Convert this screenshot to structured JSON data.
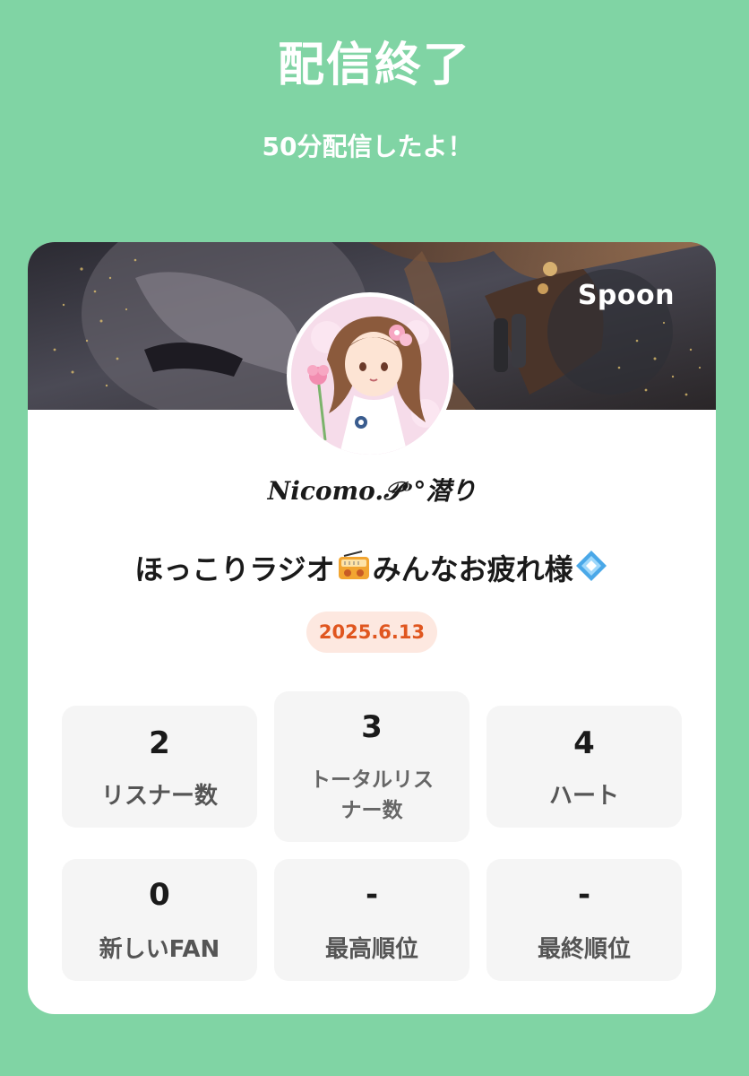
{
  "header": {
    "title": "配信終了",
    "subtitle": "50分配信したよ！"
  },
  "card": {
    "brand": "Spoon",
    "username": "Nicomo.𝒫ᵒ°潜り",
    "broadcast_title": {
      "part1": "ほっこりラジオ",
      "part2": "みんなお疲れ様"
    },
    "date": "2025.6.13",
    "icons": {
      "radio": "radio-icon",
      "diamond": "diamond-icon"
    }
  },
  "stats": {
    "listeners": {
      "value": "2",
      "label": "リスナー数"
    },
    "total_listeners": {
      "value": "3",
      "label_line1": "トータルリス",
      "label_line2": "ナー数"
    },
    "hearts": {
      "value": "4",
      "label": "ハート"
    },
    "new_fans": {
      "value": "0",
      "label": "新しいFAN"
    },
    "best_rank": {
      "value": "-",
      "label": "最高順位"
    },
    "final_rank": {
      "value": "-",
      "label": "最終順位"
    }
  },
  "colors": {
    "background": "#80d4a4",
    "card": "#ffffff",
    "date_badge_bg": "#fde8e0",
    "date_badge_text": "#e0561f",
    "stat_bg": "#f5f5f5"
  }
}
